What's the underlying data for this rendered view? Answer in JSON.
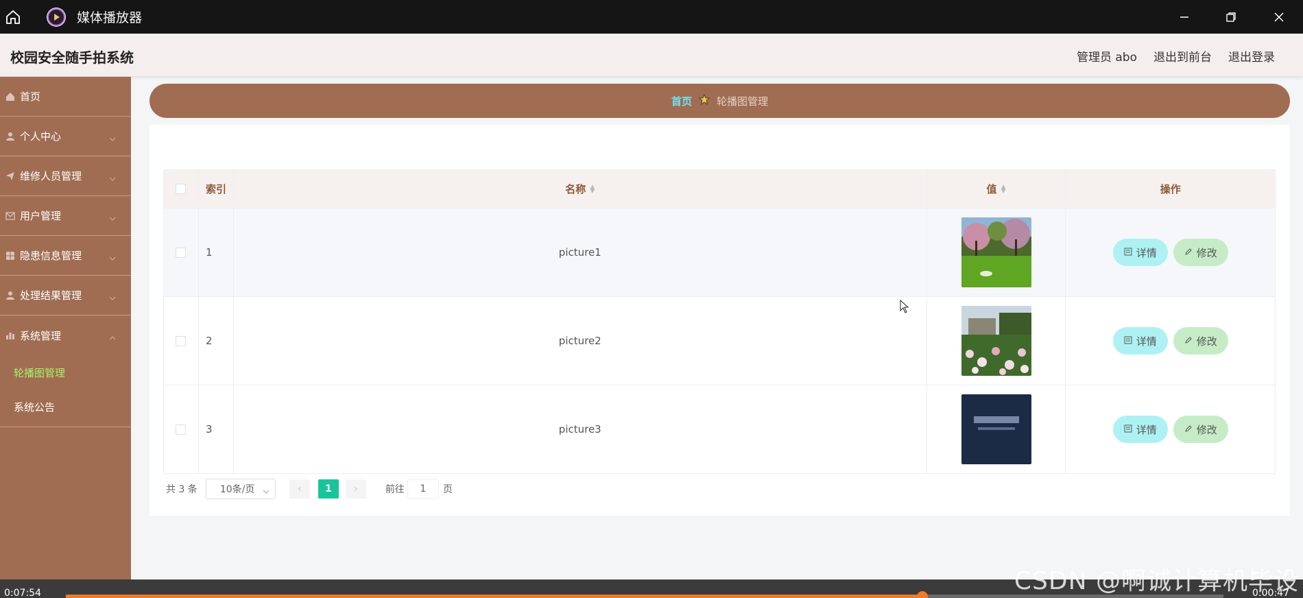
{
  "window": {
    "title": "媒体播放器",
    "icons": [
      "home-icon",
      "play-icon",
      "minimize-icon",
      "maximize-icon",
      "close-icon"
    ]
  },
  "header": {
    "system_title": "校园安全随手拍系统",
    "admin_label": "管理员 abo",
    "to_front_label": "退出到前台",
    "logout_label": "退出登录"
  },
  "sidebar": {
    "items": [
      {
        "label": "首页",
        "icon": "home-icon"
      },
      {
        "label": "个人中心",
        "icon": "user-icon"
      },
      {
        "label": "维修人员管理",
        "icon": "send-icon"
      },
      {
        "label": "用户管理",
        "icon": "mail-icon"
      },
      {
        "label": "隐患信息管理",
        "icon": "grid-icon"
      },
      {
        "label": "处理结果管理",
        "icon": "user-icon"
      },
      {
        "label": "系统管理",
        "icon": "chart-icon"
      }
    ],
    "sub_items": [
      {
        "label": "轮播图管理",
        "active": true
      },
      {
        "label": "系统公告",
        "active": false
      }
    ],
    "active_color": "#a8f06a"
  },
  "breadcrumb": {
    "home": "首页",
    "current": "轮播图管理"
  },
  "table": {
    "headers": {
      "index": "索引",
      "name": "名称",
      "value": "值",
      "ops": "操作"
    },
    "rows": [
      {
        "index": "1",
        "name": "picture1",
        "thumb": "park-lawn"
      },
      {
        "index": "2",
        "name": "picture2",
        "thumb": "rose-garden"
      },
      {
        "index": "3",
        "name": "picture3",
        "thumb": "dark-sign"
      }
    ],
    "detail_label": "详情",
    "edit_label": "修改"
  },
  "pagination": {
    "total_text": "共 3 条",
    "page_size": "10条/页",
    "current_page": "1",
    "goto_label": "前往",
    "goto_value": "1",
    "unit": "页"
  },
  "player": {
    "current_time": "0:07:54",
    "total_time": "0:00:47",
    "progress": 0.74,
    "accent": "#f07a2a"
  },
  "watermark": "CSDN @啊诚计算机毕设",
  "colors": {
    "sidebar": "#a06d52",
    "header_bg": "#f5eeee",
    "breadcrumb_home": "#6fe2f0",
    "page_active": "#19c49b",
    "detail_btn": "#aef1f3",
    "edit_btn": "#c6ecc7"
  }
}
